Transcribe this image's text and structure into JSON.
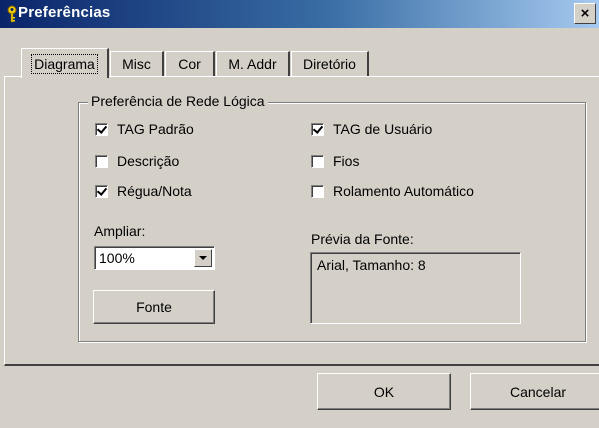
{
  "window": {
    "title": "Preferências",
    "close_glyph": "×"
  },
  "tabs": [
    {
      "label": "Diagrama",
      "active": true
    },
    {
      "label": "Misc"
    },
    {
      "label": "Cor"
    },
    {
      "label": "M. Addr"
    },
    {
      "label": "Diretório"
    }
  ],
  "group": {
    "title": "Preferência de Rede Lógica",
    "checkboxes": [
      {
        "label": "TAG Padrão",
        "checked": true
      },
      {
        "label": "Descrição",
        "checked": false
      },
      {
        "label": "Régua/Nota",
        "checked": true
      },
      {
        "label": "TAG de Usuário",
        "checked": true
      },
      {
        "label": "Fios",
        "checked": false
      },
      {
        "label": "Rolamento Automático",
        "checked": false
      }
    ],
    "zoom": {
      "label": "Ampliar:",
      "value": "100%"
    },
    "font_button": "Fonte",
    "font_preview": {
      "label": "Prévia da Fonte:",
      "text": "Arial, Tamanho: 8"
    }
  },
  "buttons": {
    "ok": "OK",
    "cancel": "Cancelar"
  },
  "icons": {
    "title": "key-icon",
    "close": "close-icon",
    "dropdown": "chevron-down-icon"
  }
}
